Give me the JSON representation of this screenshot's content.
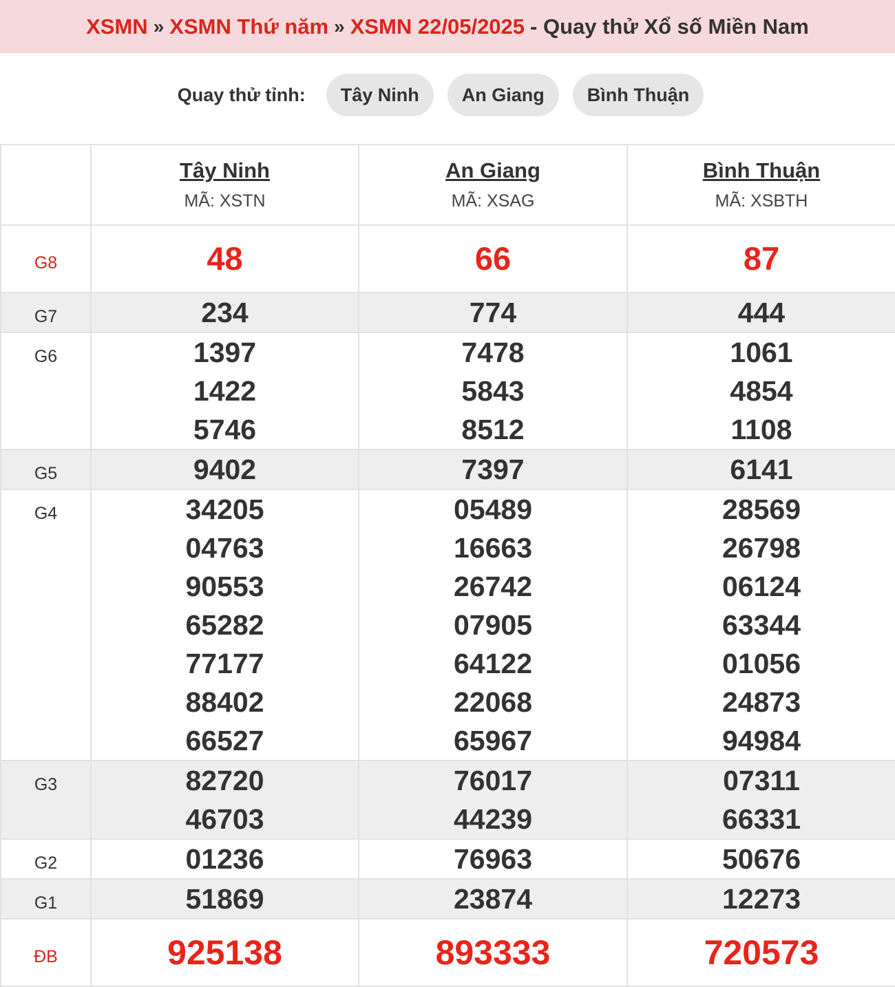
{
  "breadcrumb": {
    "items": [
      "XSMN",
      "XSMN Thứ năm",
      "XSMN 22/05/2025"
    ],
    "separator": "»",
    "suffix": "- Quay thử Xổ số Miền Nam"
  },
  "tabs": {
    "label": "Quay thử tỉnh:",
    "items": [
      "Tây Ninh",
      "An Giang",
      "Bình Thuận"
    ]
  },
  "provinces": [
    {
      "name": "Tây Ninh",
      "code": "MÃ: XSTN"
    },
    {
      "name": "An Giang",
      "code": "MÃ: XSAG"
    },
    {
      "name": "Bình Thuận",
      "code": "MÃ: XSBTH"
    }
  ],
  "prizes": [
    {
      "label": "G8",
      "values": [
        [
          "48"
        ],
        [
          "66"
        ],
        [
          "87"
        ]
      ]
    },
    {
      "label": "G7",
      "values": [
        [
          "234"
        ],
        [
          "774"
        ],
        [
          "444"
        ]
      ]
    },
    {
      "label": "G6",
      "values": [
        [
          "1397",
          "1422",
          "5746"
        ],
        [
          "7478",
          "5843",
          "8512"
        ],
        [
          "1061",
          "4854",
          "1108"
        ]
      ]
    },
    {
      "label": "G5",
      "values": [
        [
          "9402"
        ],
        [
          "7397"
        ],
        [
          "6141"
        ]
      ]
    },
    {
      "label": "G4",
      "values": [
        [
          "34205",
          "04763",
          "90553",
          "65282",
          "77177",
          "88402",
          "66527"
        ],
        [
          "05489",
          "16663",
          "26742",
          "07905",
          "64122",
          "22068",
          "65967"
        ],
        [
          "28569",
          "26798",
          "06124",
          "63344",
          "01056",
          "24873",
          "94984"
        ]
      ]
    },
    {
      "label": "G3",
      "values": [
        [
          "82720",
          "46703"
        ],
        [
          "76017",
          "44239"
        ],
        [
          "07311",
          "66331"
        ]
      ]
    },
    {
      "label": "G2",
      "values": [
        [
          "01236"
        ],
        [
          "76963"
        ],
        [
          "50676"
        ]
      ]
    },
    {
      "label": "G1",
      "values": [
        [
          "51869"
        ],
        [
          "23874"
        ],
        [
          "12273"
        ]
      ]
    },
    {
      "label": "ĐB",
      "values": [
        [
          "925138"
        ],
        [
          "893333"
        ],
        [
          "720573"
        ]
      ]
    }
  ],
  "colors": {
    "accent": "#d9251d",
    "header_bg": "#f6d9dc",
    "row_shade": "#eeeeee",
    "pill_bg": "#e6e6e6"
  }
}
